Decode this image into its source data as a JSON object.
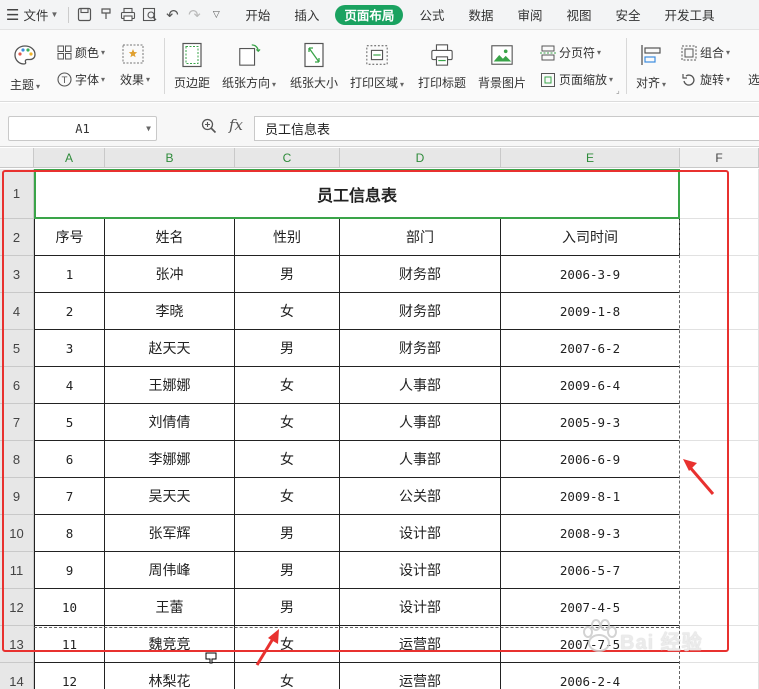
{
  "menubar": {
    "file_label": "文件",
    "tabs": [
      "开始",
      "插入",
      "页面布局",
      "公式",
      "数据",
      "审阅",
      "视图",
      "安全",
      "开发工具"
    ],
    "active_tab_index": 2,
    "active_color": "#1aa260"
  },
  "ribbon": {
    "theme": "主题",
    "colors": "颜色",
    "fonts": "字体",
    "effects": "效果",
    "margins": "页边距",
    "orientation": "纸张方向",
    "size": "纸张大小",
    "print_area": "打印区域",
    "print_titles": "打印标题",
    "background": "背景图片",
    "page_break": "分页符",
    "page_scale": "页面缩放",
    "group": "组合",
    "align": "对齐",
    "rotate": "旋转",
    "select": "选"
  },
  "formula_bar": {
    "cell_ref": "A1",
    "fx_label": "fx",
    "content": "员工信息表"
  },
  "sheet": {
    "columns": [
      "A",
      "B",
      "C",
      "D",
      "E",
      "F"
    ],
    "rows": [
      "1",
      "2",
      "3",
      "4",
      "5",
      "6",
      "7",
      "8",
      "9",
      "10",
      "11",
      "12",
      "13",
      "14"
    ],
    "title": "员工信息表",
    "headers": [
      "序号",
      "姓名",
      "性别",
      "部门",
      "入司时间"
    ],
    "data": [
      [
        "1",
        "张冲",
        "男",
        "财务部",
        "2006-3-9"
      ],
      [
        "2",
        "李晓",
        "女",
        "财务部",
        "2009-1-8"
      ],
      [
        "3",
        "赵天天",
        "男",
        "财务部",
        "2007-6-2"
      ],
      [
        "4",
        "王娜娜",
        "女",
        "人事部",
        "2009-6-4"
      ],
      [
        "5",
        "刘倩倩",
        "女",
        "人事部",
        "2005-9-3"
      ],
      [
        "6",
        "李娜娜",
        "女",
        "人事部",
        "2006-6-9"
      ],
      [
        "7",
        "吴天天",
        "女",
        "公关部",
        "2009-8-1"
      ],
      [
        "8",
        "张军辉",
        "男",
        "设计部",
        "2008-9-3"
      ],
      [
        "9",
        "周伟峰",
        "男",
        "设计部",
        "2006-5-7"
      ],
      [
        "10",
        "王蕾",
        "男",
        "设计部",
        "2007-4-5"
      ],
      [
        "11",
        "魏竞竞",
        "女",
        "运营部",
        "2007-7-5"
      ],
      [
        "12",
        "林梨花",
        "女",
        "运营部",
        "2006-2-4"
      ]
    ],
    "grid_accent": "#3aa449"
  },
  "annotations": {
    "box_color": "#e8312f",
    "watermark": "Bai 经验"
  }
}
